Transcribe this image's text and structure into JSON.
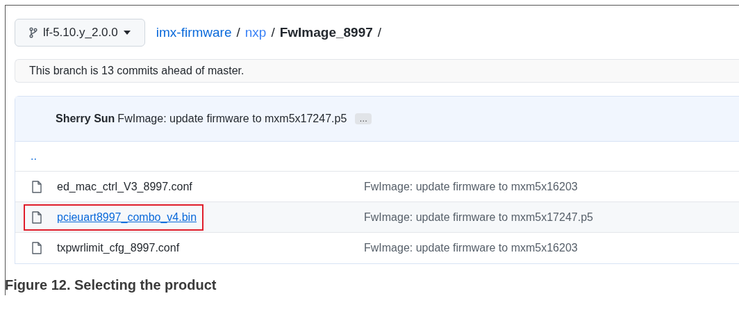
{
  "branch": {
    "label": "lf-5.10.y_2.0.0"
  },
  "breadcrumb": [
    {
      "label": "imx-firmware",
      "kind": "link"
    },
    {
      "label": "nxp",
      "kind": "link"
    },
    {
      "label": "FwImage_8997",
      "kind": "current"
    }
  ],
  "breadcrumb_separator": "/",
  "notice": "This branch is 13 commits ahead of master.",
  "commit": {
    "author": "Sherry Sun",
    "message": "FwImage: update firmware to mxm5x17247.p5",
    "more": "…"
  },
  "parent_link": "..",
  "files": [
    {
      "name": "ed_mac_ctrl_V3_8997.conf",
      "message": "FwImage: update firmware to mxm5x16203",
      "selected": false
    },
    {
      "name": "pcieuart8997_combo_v4.bin",
      "message": "FwImage: update firmware to mxm5x17247.p5",
      "selected": true
    },
    {
      "name": "txpwrlimit_cfg_8997.conf",
      "message": "FwImage: update firmware to mxm5x16203",
      "selected": false
    }
  ],
  "caption": "Figure 12.  Selecting the product"
}
